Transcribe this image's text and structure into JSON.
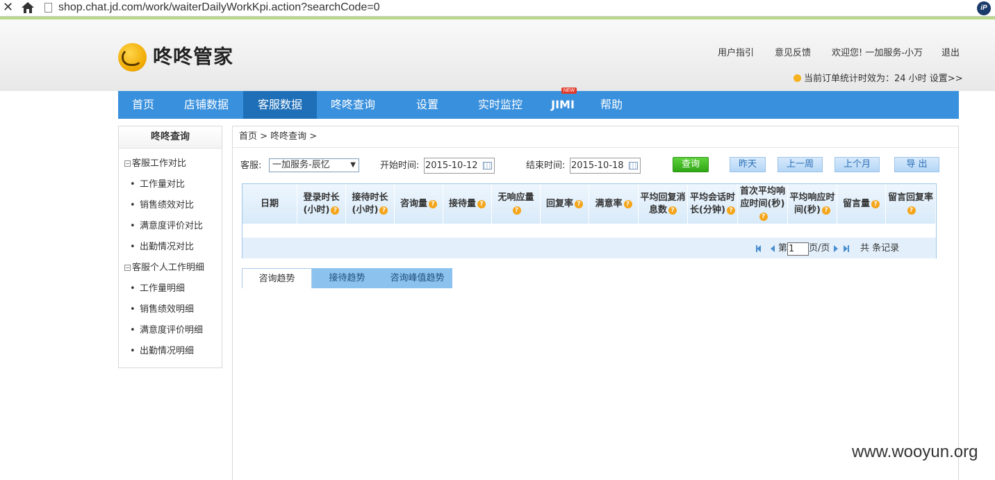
{
  "browser": {
    "url": "shop.chat.jd.com/work/waiterDailyWorkKpi.action?searchCode=0",
    "close_glyph": "✕",
    "ip_badge": "iP"
  },
  "header": {
    "logo_text": "咚咚管家",
    "links": [
      "用户指引",
      "意见反馈",
      "欢迎您! 一加服务-小万",
      "退出"
    ],
    "order_hint": "当前订单统计时效为：24 小时 设置>>"
  },
  "nav": {
    "items": [
      "首页",
      "店铺数据",
      "客服数据",
      "咚咚查询",
      "设置",
      "实时监控",
      "JIMI",
      "帮助"
    ],
    "active": "客服数据",
    "badge": "NEW"
  },
  "sidebar": {
    "title": "咚咚查询",
    "groups": [
      {
        "label": "客服工作对比",
        "items": [
          "工作量对比",
          "销售绩效对比",
          "满意度评价对比",
          "出勤情况对比"
        ]
      },
      {
        "label": "客服个人工作明细",
        "items": [
          "工作量明细",
          "销售绩效明细",
          "满意度评价明细",
          "出勤情况明细"
        ]
      }
    ],
    "expander": "⊟"
  },
  "breadcrumb": "首页 > 咚咚查询 >",
  "filter": {
    "agent_label": "客服:",
    "agent_value": "一加服务-辰忆",
    "start_label": "开始时间:",
    "start_value": "2015-10-12",
    "end_label": "结束时间:",
    "end_value": "2015-10-18",
    "buttons": [
      "查询",
      "昨天",
      "上一周",
      "上个月",
      "导 出"
    ]
  },
  "table": {
    "headers": [
      {
        "label": "日期",
        "help": false
      },
      {
        "label": "登录时长(小时)",
        "help": true
      },
      {
        "label": "接待时长(小时)",
        "help": true
      },
      {
        "label": "咨询量",
        "help": true
      },
      {
        "label": "接待量",
        "help": true
      },
      {
        "label": "无响应量",
        "help": true
      },
      {
        "label": "回复率",
        "help": true
      },
      {
        "label": "满意率",
        "help": true
      },
      {
        "label": "平均回复消息数",
        "help": true
      },
      {
        "label": "平均会话时长(分钟)",
        "help": true
      },
      {
        "label": "首次平均响应时间(秒)",
        "help": true
      },
      {
        "label": "平均响应时间(秒)",
        "help": true
      },
      {
        "label": "留言量",
        "help": true
      },
      {
        "label": "留言回复率",
        "help": true
      }
    ],
    "help_glyph": "?",
    "rows": []
  },
  "pager": {
    "prefix": "第",
    "page": "1",
    "suffix": "页/页",
    "total": "共 条记录"
  },
  "trend_tabs": [
    "咨询趋势",
    "接待趋势",
    "咨询峰值趋势"
  ],
  "active_trend_tab": "咨询趋势",
  "watermark": "www.wooyun.org",
  "colors": {
    "nav_bg": "#3990dd",
    "nav_active": "#1e6fb8",
    "query_button": "#3fb524",
    "help_icon": "#f5a51a",
    "table_header": "#d8eaf9"
  }
}
